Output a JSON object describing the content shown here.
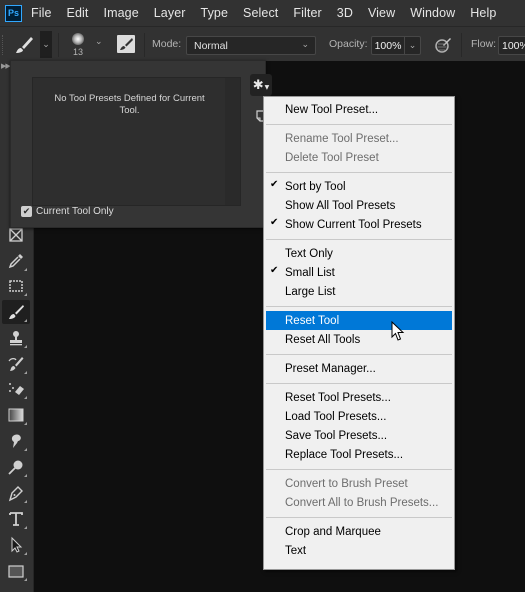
{
  "app": {
    "logo": "Ps"
  },
  "menubar": {
    "items": [
      "File",
      "Edit",
      "Image",
      "Layer",
      "Type",
      "Select",
      "Filter",
      "3D",
      "View",
      "Window",
      "Help"
    ]
  },
  "options_bar": {
    "brush_size": "13",
    "mode_label": "Mode:",
    "mode_value": "Normal",
    "opacity_label": "Opacity:",
    "opacity_value": "100%",
    "flow_label": "Flow:",
    "flow_value": "100%"
  },
  "toolbar": {
    "tools": [
      {
        "name": "frame-tool",
        "active": false
      },
      {
        "name": "eyedropper-tool",
        "active": false
      },
      {
        "name": "spot-healing-tool",
        "active": false
      },
      {
        "name": "brush-tool",
        "active": true
      },
      {
        "name": "clone-stamp-tool",
        "active": false
      },
      {
        "name": "history-brush-tool",
        "active": false
      },
      {
        "name": "eraser-tool",
        "active": false
      },
      {
        "name": "gradient-tool",
        "active": false
      },
      {
        "name": "blur-tool",
        "active": false
      },
      {
        "name": "dodge-tool",
        "active": false
      },
      {
        "name": "pen-tool",
        "active": false
      },
      {
        "name": "type-tool",
        "active": false
      },
      {
        "name": "path-selection-tool",
        "active": false
      },
      {
        "name": "rectangle-tool",
        "active": false
      }
    ]
  },
  "presets_panel": {
    "empty_message": "No Tool Presets Defined for Current Tool.",
    "current_tool_only_label": "Current Tool Only",
    "current_tool_only_checked": true
  },
  "context_menu": {
    "groups": [
      [
        {
          "label": "New Tool Preset...",
          "enabled": true,
          "checked": false
        }
      ],
      [
        {
          "label": "Rename Tool Preset...",
          "enabled": false,
          "checked": false
        },
        {
          "label": "Delete Tool Preset",
          "enabled": false,
          "checked": false
        }
      ],
      [
        {
          "label": "Sort by Tool",
          "enabled": true,
          "checked": true
        },
        {
          "label": "Show All Tool Presets",
          "enabled": true,
          "checked": false
        },
        {
          "label": "Show Current Tool Presets",
          "enabled": true,
          "checked": true
        }
      ],
      [
        {
          "label": "Text Only",
          "enabled": true,
          "checked": false
        },
        {
          "label": "Small List",
          "enabled": true,
          "checked": true
        },
        {
          "label": "Large List",
          "enabled": true,
          "checked": false
        }
      ],
      [
        {
          "label": "Reset Tool",
          "enabled": true,
          "checked": false,
          "highlighted": true
        },
        {
          "label": "Reset All Tools",
          "enabled": true,
          "checked": false
        }
      ],
      [
        {
          "label": "Preset Manager...",
          "enabled": true,
          "checked": false
        }
      ],
      [
        {
          "label": "Reset Tool Presets...",
          "enabled": true,
          "checked": false
        },
        {
          "label": "Load Tool Presets...",
          "enabled": true,
          "checked": false
        },
        {
          "label": "Save Tool Presets...",
          "enabled": true,
          "checked": false
        },
        {
          "label": "Replace Tool Presets...",
          "enabled": true,
          "checked": false
        }
      ],
      [
        {
          "label": "Convert to Brush Preset",
          "enabled": false,
          "checked": false
        },
        {
          "label": "Convert All to Brush Presets...",
          "enabled": false,
          "checked": false
        }
      ],
      [
        {
          "label": "Crop and Marquee",
          "enabled": true,
          "checked": false
        },
        {
          "label": "Text",
          "enabled": true,
          "checked": false
        }
      ]
    ],
    "check_glyph": "✔"
  },
  "colors": {
    "highlight": "#0078d7",
    "ps_blue": "#31a8ff",
    "ui_dark": "#323232"
  }
}
